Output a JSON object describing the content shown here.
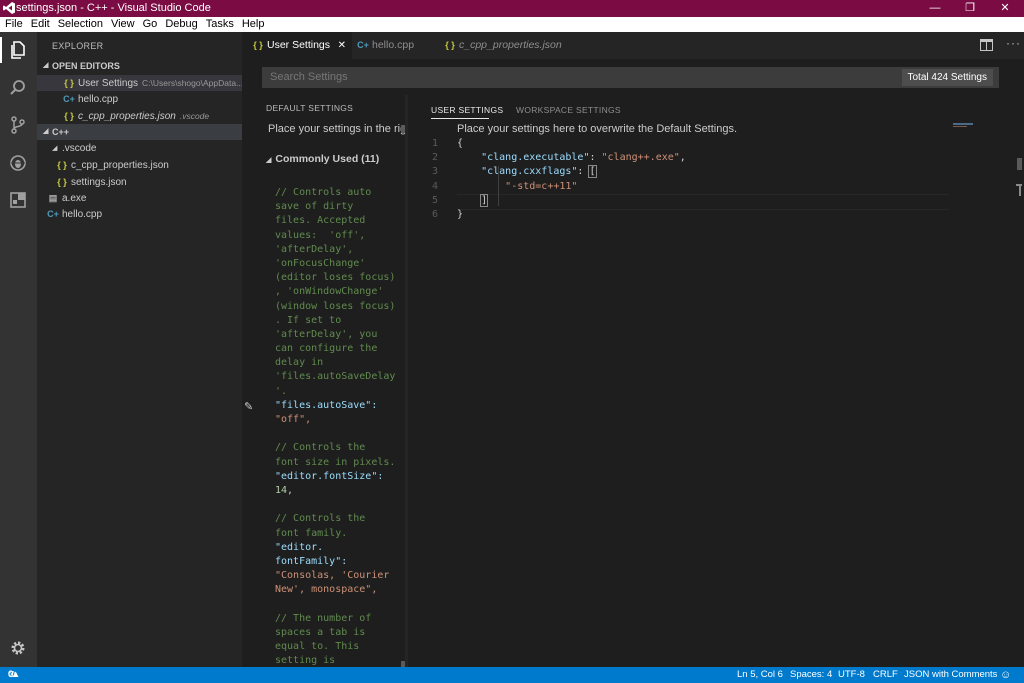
{
  "window": {
    "title": "settings.json - C++ - Visual Studio Code",
    "minimize_glyph": "—",
    "restore_glyph": "❐",
    "close_glyph": "✕"
  },
  "menu": [
    "File",
    "Edit",
    "Selection",
    "View",
    "Go",
    "Debug",
    "Tasks",
    "Help"
  ],
  "activity_bar": {
    "items": [
      "files-icon",
      "search-icon",
      "source-control-icon",
      "debug-icon",
      "extensions-icon"
    ],
    "bottom": "gear-icon"
  },
  "sidebar": {
    "header": "EXPLORER",
    "open_editors": {
      "label": "OPEN EDITORS",
      "items": [
        {
          "icon": "json-file-icon",
          "glyph": "{ }",
          "name": "User Settings",
          "desc": "C:\\Users\\shogo\\AppData..."
        },
        {
          "icon": "cpp-file-icon",
          "glyph": "C+",
          "name": "hello.cpp",
          "desc": ""
        },
        {
          "icon": "json-file-icon",
          "glyph": "{ }",
          "name": "c_cpp_properties.json",
          "desc": ".vscode"
        }
      ]
    },
    "folder": {
      "label": "C++",
      "items": [
        {
          "name": ".vscode",
          "type": "folder",
          "glyph": ""
        },
        {
          "name": "c_cpp_properties.json",
          "type": "json",
          "glyph": "{ }"
        },
        {
          "name": "settings.json",
          "type": "json",
          "glyph": "{ }"
        },
        {
          "name": "a.exe",
          "type": "exe",
          "glyph": "▤"
        },
        {
          "name": "hello.cpp",
          "type": "cpp",
          "glyph": "C+"
        }
      ]
    }
  },
  "tabs": [
    {
      "glyph": "{ }",
      "label": "User Settings",
      "close": "✕"
    },
    {
      "glyph": "C+",
      "label": "hello.cpp"
    },
    {
      "glyph": "{ }",
      "label": "c_cpp_properties.json"
    }
  ],
  "search": {
    "placeholder": "Search Settings",
    "count": "Total 424 Settings"
  },
  "default_settings": {
    "header": "DEFAULT SETTINGS",
    "intro": "Place your settings in the righ",
    "group": "Commonly Used (11)",
    "group_arrow": "◢",
    "pencil_glyph": "✎",
    "lines": [
      {
        "t": "// Controls auto",
        "c": "com"
      },
      {
        "t": "save of dirty",
        "c": "com"
      },
      {
        "t": "files. Accepted",
        "c": "com"
      },
      {
        "t": "values:  'off',",
        "c": "com"
      },
      {
        "t": "'afterDelay',",
        "c": "com"
      },
      {
        "t": "'onFocusChange'",
        "c": "com"
      },
      {
        "t": "(editor loses focus)",
        "c": "com"
      },
      {
        "t": ", 'onWindowChange'",
        "c": "com"
      },
      {
        "t": "(window loses focus)",
        "c": "com"
      },
      {
        "t": ". If set to",
        "c": "com"
      },
      {
        "t": "'afterDelay', you",
        "c": "com"
      },
      {
        "t": "can configure the",
        "c": "com"
      },
      {
        "t": "delay in",
        "c": "com"
      },
      {
        "t": "'files.autoSaveDelay",
        "c": "com"
      },
      {
        "t": "'.",
        "c": "com"
      },
      {
        "t": "\"files.autoSave\":",
        "c": "key"
      },
      {
        "t": "\"off\",",
        "c": "str"
      },
      {
        "t": "",
        "c": "pun"
      },
      {
        "t": "// Controls the",
        "c": "com"
      },
      {
        "t": "font size in pixels.",
        "c": "com"
      },
      {
        "t": "\"editor.fontSize\":",
        "c": "key"
      },
      {
        "t": "14,",
        "c": "num"
      },
      {
        "t": "",
        "c": "pun"
      },
      {
        "t": "// Controls the",
        "c": "com"
      },
      {
        "t": "font family.",
        "c": "com"
      },
      {
        "t": "\"editor.",
        "c": "key"
      },
      {
        "t": "fontFamily\":",
        "c": "key"
      },
      {
        "t": "\"Consolas, 'Courier",
        "c": "str"
      },
      {
        "t": "New', monospace\",",
        "c": "str"
      },
      {
        "t": "",
        "c": "pun"
      },
      {
        "t": "// The number of",
        "c": "com"
      },
      {
        "t": "spaces a tab is",
        "c": "com"
      },
      {
        "t": "equal to. This",
        "c": "com"
      },
      {
        "t": "setting is",
        "c": "com"
      }
    ]
  },
  "user_settings": {
    "tab_user": "USER SETTINGS",
    "tab_workspace": "WORKSPACE SETTINGS",
    "intro": "Place your settings here to overwrite the Default Settings.",
    "line_numbers": [
      "1",
      "2",
      "3",
      "4",
      "5",
      "6"
    ],
    "code": [
      "{",
      "    \"clang.executable\": \"clang++.exe\",",
      "    \"clang.cxxflags\": [",
      "        \"-std=c++11\"",
      "    ]",
      "}"
    ],
    "tokens": {
      "brace_open": "{",
      "brace_close": "}",
      "key1": "\"clang.executable\"",
      "val1": "\"clang++.exe\"",
      "key2": "\"clang.cxxflags\"",
      "bracket_open": "[",
      "val2": "\"-std=c++11\"",
      "bracket_close": "]",
      "colon": ": ",
      "comma": ","
    }
  },
  "status_bar": {
    "errors": "0",
    "warnings": "0",
    "position": "Ln 5, Col 6",
    "spaces": "Spaces: 4",
    "encoding": "UTF-8",
    "eol": "CRLF",
    "language": "JSON with Comments",
    "feedback_icon": "smiley-icon"
  },
  "colors": {
    "titlebar": "#7a0c43",
    "statusbar": "#007acc",
    "activity_bar": "#333333",
    "sidebar": "#252526",
    "editor": "#1e1e1e"
  }
}
